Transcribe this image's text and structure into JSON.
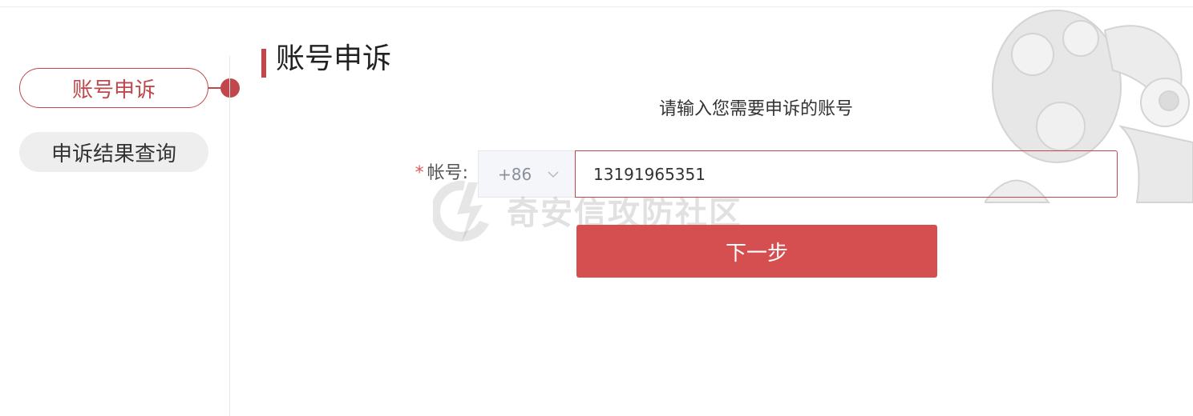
{
  "sidebar": {
    "items": [
      {
        "label": "账号申诉",
        "active": true
      },
      {
        "label": "申诉结果查询",
        "active": false
      }
    ]
  },
  "main": {
    "title": "账号申诉",
    "prompt": "请输入您需要申诉的账号",
    "account_field": {
      "required_mark": "*",
      "label": "帐号:",
      "country_code": "+86",
      "value": "13191965351"
    },
    "next_button_label": "下一步"
  },
  "watermark": {
    "text": "奇安信攻防社区"
  },
  "colors": {
    "accent": "#c0474b",
    "button": "#d54e50",
    "sidebar_inactive_bg": "#eeeeee"
  },
  "icons": [
    "chevron-down-icon",
    "mascot-illustration",
    "lightning-logo-watermark"
  ]
}
